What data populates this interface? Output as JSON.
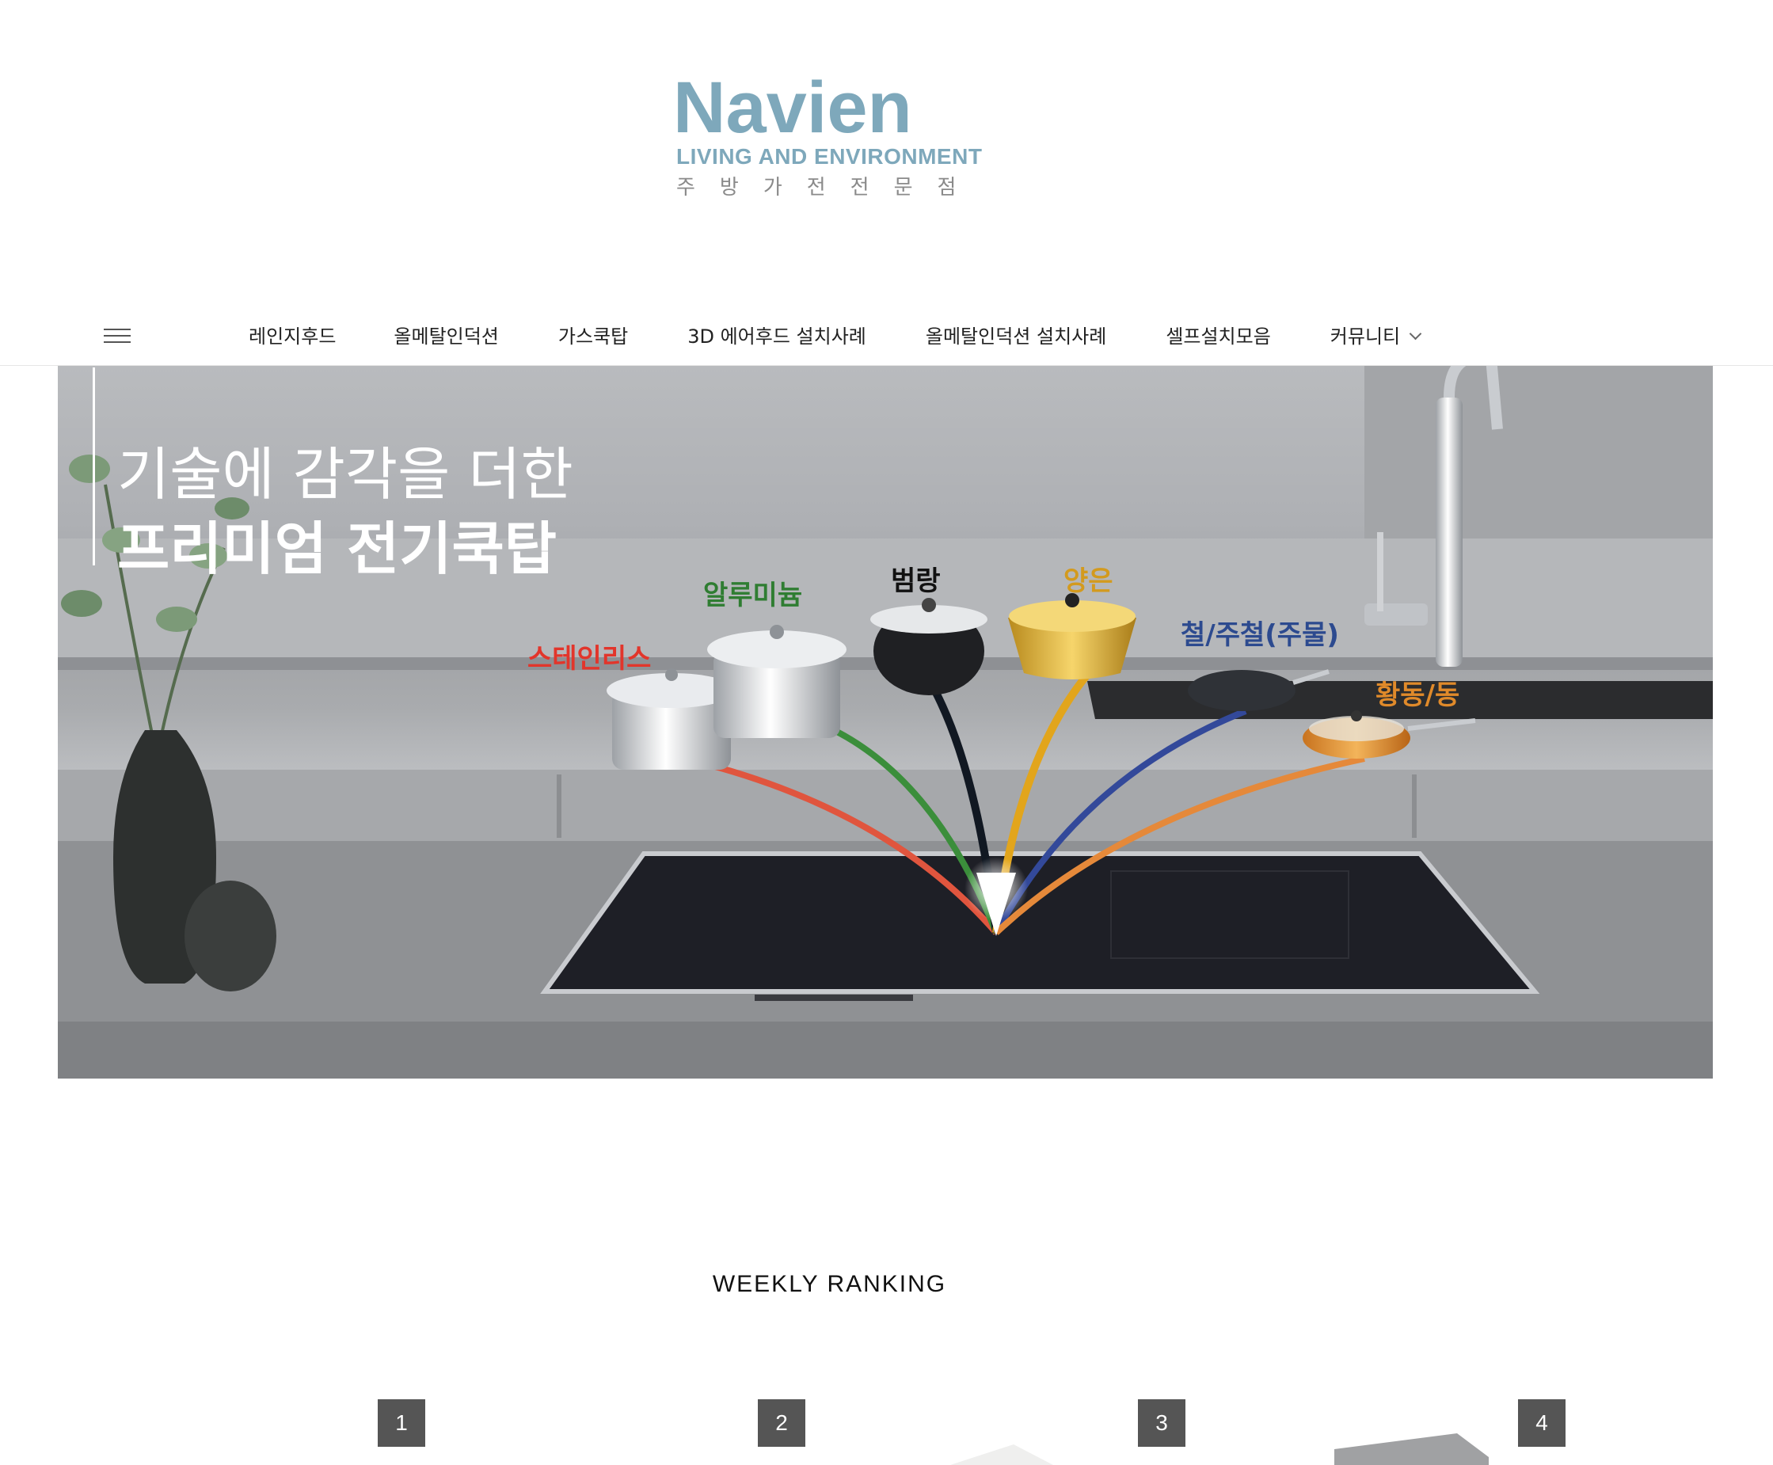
{
  "logo": {
    "wordmark": "Navien",
    "tagline": "LIVING AND ENVIRONMENT",
    "subtitle": "주방가전전문점",
    "brand_color": "#7ea8bb"
  },
  "nav": {
    "menu_icon": "hamburger-menu-icon",
    "items": [
      {
        "label": "레인지후드"
      },
      {
        "label": "올메탈인덕션"
      },
      {
        "label": "가스쿡탑"
      },
      {
        "label": "3D 에어후드 설치사례"
      },
      {
        "label": "올메탈인덕션 설치사례"
      },
      {
        "label": "셀프설치모음"
      },
      {
        "label": "커뮤니티",
        "icon": "chevron-down-icon"
      }
    ]
  },
  "banner": {
    "line1": "기술에 감각을 더한",
    "line2": "프리미엄 전기쿡탑",
    "cookware": [
      {
        "label": "스테인리스",
        "color": "#e2352b"
      },
      {
        "label": "알루미늄",
        "color": "#2f7d32"
      },
      {
        "label": "범랑",
        "color": "#111111"
      },
      {
        "label": "양은",
        "color": "#d39a1e"
      },
      {
        "label": "철/주철(주물)",
        "color": "#2c4a8f"
      },
      {
        "label": "황동/동",
        "color": "#e08a2a"
      }
    ]
  },
  "ranking": {
    "title": "WEEKLY RANKING",
    "badges": [
      "1",
      "2",
      "3",
      "4"
    ]
  }
}
